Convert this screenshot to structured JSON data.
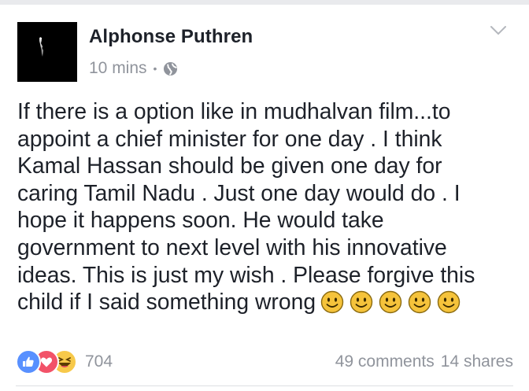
{
  "post": {
    "author": "Alphonse Puthren",
    "time": "10 mins",
    "separator": "•",
    "privacy_icon": "globe-icon",
    "menu_icon": "chevron-down-icon",
    "text": "If there is a option like in mudhalvan film...to\nappoint a chief minister for one day . I think\nKamal Hassan should be given one day for\ncaring Tamil Nadu . Just one day would do . I\nhope it happens soon. He would take\ngovernment to next level with his innovative\nideas. This is just my wish . Please forgive this\nchild if I said something wrong",
    "trailing_emojis": [
      "smiley-icon",
      "smiley-icon",
      "smiley-icon",
      "smiley-icon",
      "smiley-icon"
    ]
  },
  "footer": {
    "reactions": [
      "like-icon",
      "love-icon",
      "haha-icon"
    ],
    "reaction_count": "704",
    "comments": "49 comments",
    "shares": "14 shares"
  },
  "colors": {
    "text": "#1d2129",
    "meta": "#90949c",
    "like": "#5890ff",
    "love": "#f25268",
    "haha": "#f7c94a",
    "smiley": "#f5c33b"
  }
}
